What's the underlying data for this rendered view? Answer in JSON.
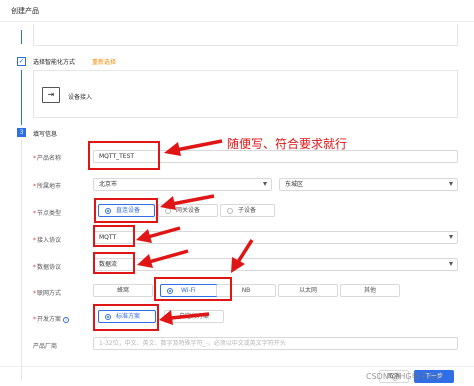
{
  "dialog": {
    "title": "创建产品"
  },
  "step_method": {
    "title": "选择智能化方式",
    "reselect": "重新选择",
    "card_label": "设备接入"
  },
  "step_info": {
    "number": "3",
    "title": "填写信息"
  },
  "annotation": {
    "text": "随便写、符合要求就行"
  },
  "form": {
    "product_name": {
      "label": "产品名称",
      "value": "MQTT_TEST"
    },
    "region": {
      "label": "所属地市",
      "city": "北京市",
      "district": "东城区"
    },
    "node_type": {
      "label": "节点类型",
      "options": [
        "直连设备",
        "网关设备",
        "子设备"
      ],
      "selected": "直连设备"
    },
    "access_protocol": {
      "label": "接入协议",
      "value": "MQTT"
    },
    "data_protocol": {
      "label": "数据协议",
      "value": "数据流"
    },
    "network": {
      "label": "联网方式",
      "options": [
        "蜂窝",
        "Wi-Fi",
        "NB",
        "以太网",
        "其他"
      ],
      "selected": "Wi-Fi"
    },
    "dev_plan": {
      "label": "开发方案",
      "options": [
        "标准方案",
        "自定义方案"
      ],
      "selected": "标准方案"
    },
    "vendor": {
      "label": "产品厂商",
      "placeholder": "1-32位，中文、英文、数字及特殊字符_-，必须以中文或英文字符开头"
    }
  },
  "footer": {
    "cancel": "取消",
    "next": "下一步"
  },
  "watermark": "CSDN @HG电子设计",
  "colors": {
    "accent": "#2e6ee6",
    "annotation": "#e01515"
  }
}
